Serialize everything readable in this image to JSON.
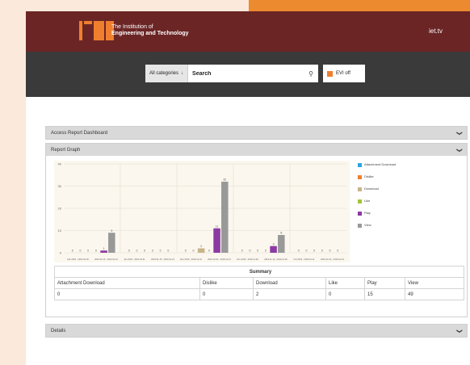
{
  "header": {
    "logo_line1": "The Institution of",
    "logo_line2": "Engineering and Technology",
    "site_link": "iet.tv",
    "brand_color": "#6b2525",
    "accent_color": "#ef7f2e"
  },
  "search": {
    "category_label": "All categories",
    "placeholder": "Search",
    "evi_label": "EVI off"
  },
  "panels": {
    "access_report": "Access Report Dashboard",
    "report_graph": "Report Graph",
    "details": "Details"
  },
  "chart_data": {
    "type": "bar",
    "ylim": [
      0,
      40
    ],
    "yticks": [
      0,
      10,
      20,
      30,
      40
    ],
    "grid": true,
    "legend_placement": "right",
    "categories": [
      "Feb 2024 - 2024-02-09",
      "2024-02-10 - 2024-02-16",
      "Jan 2024 - 2024-01-31",
      "2024-01-15 - 2024-01-21",
      "Dec 2019 - 2019-12-01",
      "2019-12-02 - 2019-12-21",
      "Nov 2019 - 2019-11-09",
      "2019-11-10 - 2019-11-30",
      "Oct 2019 - 2019-10-11",
      "2019-10-12 - 2019-10-31"
    ],
    "groups": [
      {
        "values": [
          0,
          0,
          0,
          0,
          1,
          9
        ]
      },
      {
        "values": [
          0,
          0,
          0,
          0,
          0,
          0
        ]
      },
      {
        "values": [
          0,
          0,
          2,
          0,
          11,
          32
        ]
      },
      {
        "values": [
          0,
          0,
          0,
          0,
          3,
          8
        ]
      },
      {
        "values": [
          0,
          0,
          0,
          0,
          0,
          0
        ]
      }
    ],
    "series": [
      {
        "name": "Attachment Download",
        "color": "#2aa6dd"
      },
      {
        "name": "Dislike",
        "color": "#ef7f2e"
      },
      {
        "name": "Download",
        "color": "#c8b48a"
      },
      {
        "name": "Like",
        "color": "#a5c23a"
      },
      {
        "name": "Play",
        "color": "#8c3aa3"
      },
      {
        "name": "View",
        "color": "#999999"
      }
    ]
  },
  "summary": {
    "title": "Summary",
    "headers": [
      "Attachment Download",
      "Dislike",
      "Download",
      "Like",
      "Play",
      "View"
    ],
    "values": [
      "0",
      "0",
      "2",
      "0",
      "15",
      "49"
    ]
  }
}
